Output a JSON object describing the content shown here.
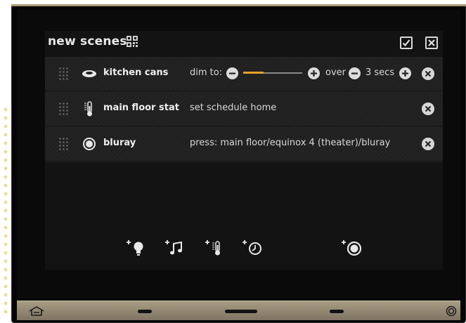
{
  "title": "new scenes",
  "header": {
    "confirm_icon": "checkmark-icon",
    "cancel_icon": "close-icon",
    "qr_icon": "qr-code-icon"
  },
  "rows": [
    {
      "name": "kitchen cans",
      "icon": "ceiling-light-icon",
      "dim_label": "dim to:",
      "dim_level": 0.35,
      "over_label": "over",
      "duration": "3 secs"
    },
    {
      "name": "main floor stat",
      "icon": "thermometer-icon",
      "action": "set schedule home"
    },
    {
      "name": "bluray",
      "icon": "record-button-icon",
      "action": "press: main floor/equinox 4 (theater)/bluray"
    }
  ],
  "add_buttons": [
    "add-light-icon",
    "add-music-icon",
    "add-thermostat-icon",
    "add-scene-icon",
    "add-button-icon"
  ],
  "colors": {
    "accent": "#e5a028",
    "text": "#e8e8e8",
    "nav": "#a89d84"
  },
  "nav": {
    "home_icon": "home-icon",
    "power_icon": "power-icon"
  }
}
